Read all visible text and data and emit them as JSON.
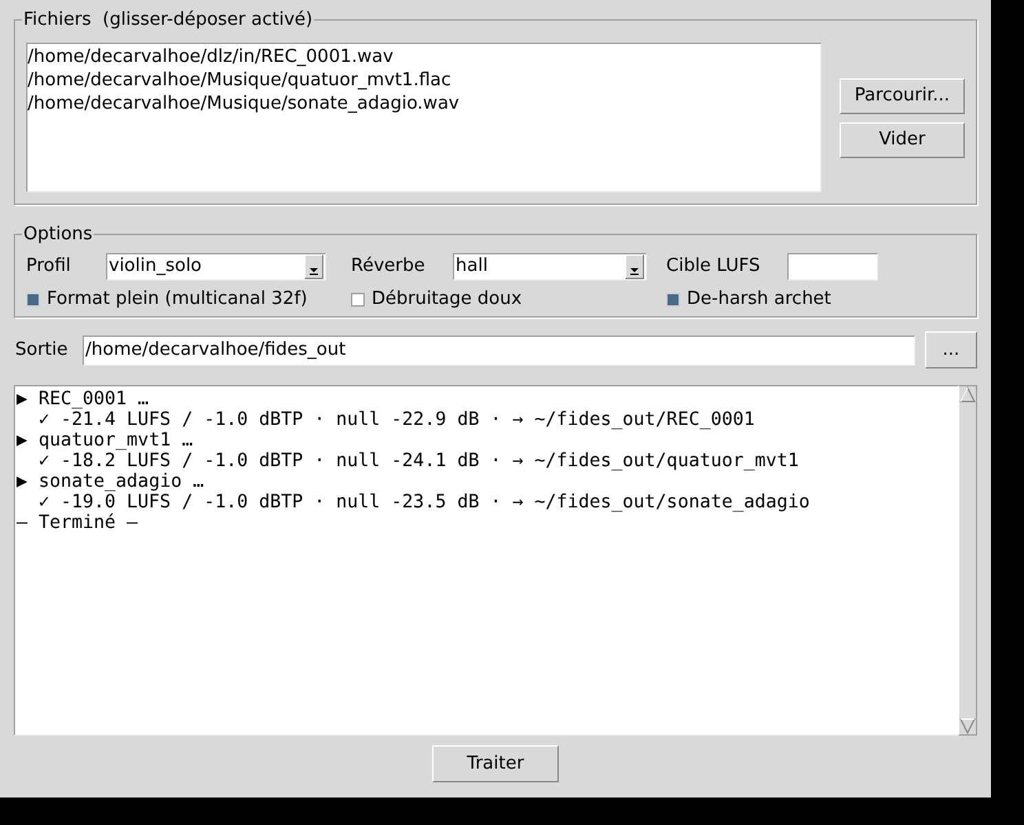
{
  "files": {
    "title": "Fichiers  (glisser-déposer activé)",
    "items": [
      "/home/decarvalhoe/dlz/in/REC_0001.wav",
      "/home/decarvalhoe/Musique/quatuor_mvt1.flac",
      "/home/decarvalhoe/Musique/sonate_adagio.wav"
    ],
    "buttons": [
      "Parcourir...",
      "Vider"
    ]
  },
  "options": {
    "title": "Options",
    "profile": {
      "label": "Profil",
      "value": "violin_solo"
    },
    "reverb": {
      "label": "Réverbe",
      "value": "hall"
    },
    "target": {
      "label": "Cible LUFS"
    },
    "checkboxes": [
      {
        "label": "Format plein (multicanal 32f)",
        "checked": true
      },
      {
        "label": "Débruitage doux",
        "checked": false
      },
      {
        "label": "De-harsh archet",
        "checked": true
      }
    ]
  },
  "output": {
    "label": "Sortie",
    "value": "/home/decarvalhoe/fides_out",
    "button": "..."
  },
  "log": {
    "lines": [
      {
        "kind": "file",
        "text": "▶ REC_0001 …"
      },
      {
        "kind": "result",
        "text": "✓ -21.4 LUFS / -1.0 dBTP · null -22.9 dB · → ~/fides_out/REC_0001"
      },
      {
        "kind": "file",
        "text": "▶ quatuor_mvt1 …"
      },
      {
        "kind": "result",
        "text": "✓ -18.2 LUFS / -1.0 dBTP · null -24.1 dB · → ~/fides_out/quatuor_mvt1"
      },
      {
        "kind": "file",
        "text": "▶ sonate_adagio …"
      },
      {
        "kind": "result",
        "text": "✓ -19.0 LUFS / -1.0 dBTP · null -23.5 dB · → ~/fides_out/sonate_adagio"
      },
      {
        "kind": "status",
        "text": "— Terminé —"
      }
    ]
  },
  "run_button": "Traiter"
}
